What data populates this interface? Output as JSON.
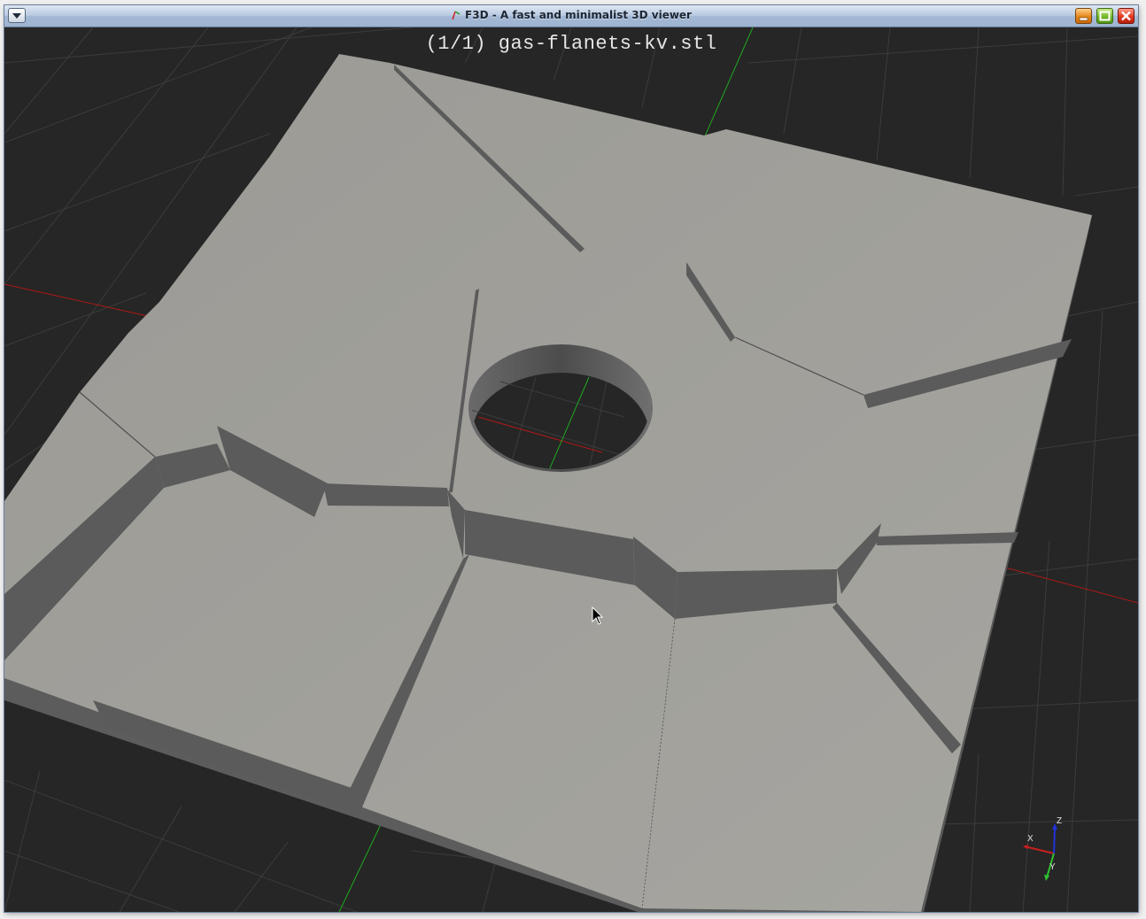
{
  "window": {
    "title": "F3D - A fast and minimalist 3D viewer"
  },
  "titlebar_buttons": {
    "menu": "menu-icon",
    "minimize": "minimize-icon",
    "maximize": "maximize-icon",
    "close": "close-icon"
  },
  "viewport": {
    "file_label": "(1/1) gas-flanets-kv.stl",
    "background": "#262626",
    "model_color": "#9a9995",
    "grid_color": "#3a3a3a"
  },
  "axes_widget": {
    "x_label": "X",
    "y_label": "Y",
    "z_label": "Z",
    "x_color": "#c81e1e",
    "y_color": "#2ec22e",
    "z_color": "#2232d8"
  }
}
